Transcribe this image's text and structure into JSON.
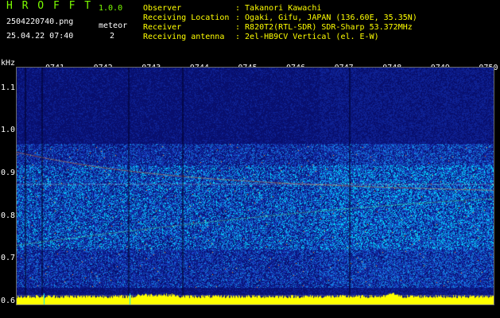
{
  "header": {
    "app_title": "H R O F F T",
    "version": "1.0.0",
    "filename": "2504220740.png",
    "datetime": "25.04.22 07:40",
    "meteor_label": "meteor",
    "meteor_count": "2"
  },
  "info": {
    "rows": [
      {
        "label": "Observer",
        "value": ": Takanori Kawachi"
      },
      {
        "label": "Receiving Location",
        "value": ": Ogaki, Gifu, JAPAN (136.60E, 35.35N)"
      },
      {
        "label": "Receiver",
        "value": ": R820T2(RTL-SDR) SDR-Sharp 53.372MHz"
      },
      {
        "label": "Receiving antenna",
        "value": ": 2el-HB9CV Vertical (el. E-W)"
      }
    ]
  },
  "spectrogram": {
    "unit_label": "kHz",
    "y_ticks": [
      "1.1",
      "1.0",
      "0.9",
      "0.8",
      "0.7",
      "0.6"
    ],
    "y_range": [
      0.59,
      1.15
    ],
    "time_labels": [
      "0741",
      "0742",
      "0743",
      "0744",
      "0745",
      "0746",
      "0747",
      "0748",
      "0749",
      "0750"
    ],
    "colors": {
      "background": "#0a1a8c",
      "signal": "#00d8ff",
      "strong": "#ff8c1a",
      "baseline": "#ffff00"
    }
  }
}
